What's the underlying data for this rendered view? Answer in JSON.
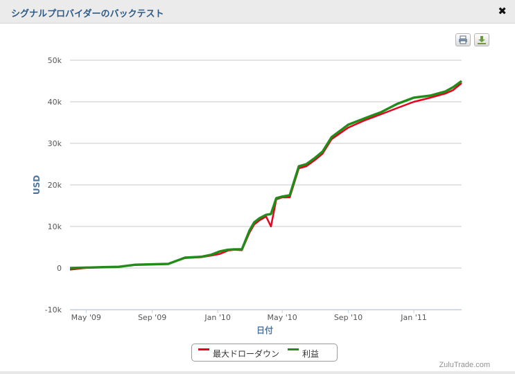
{
  "window": {
    "title": "シグナルプロバイダーのバックテスト",
    "close_symbol": "✖"
  },
  "toolbar": {
    "print_icon": "print-icon",
    "download_icon": "download-icon"
  },
  "credits": "ZuluTrade.com",
  "colors": {
    "drawdown": "#e8001c",
    "profit": "#238b1a",
    "title": "#2d5a86",
    "axis_title": "#4d759e"
  },
  "chart_data": {
    "type": "line",
    "xlabel": "日付",
    "ylabel": "USD",
    "ylim": [
      -10000,
      50000
    ],
    "yticks": [
      50000,
      40000,
      30000,
      20000,
      10000,
      0,
      -10000
    ],
    "ytick_labels": [
      "50k",
      "40k",
      "30k",
      "20k",
      "10k",
      "0",
      "-10k"
    ],
    "xlim": [
      "2009-04-01",
      "2011-03-31"
    ],
    "xticks": [
      "2009-05-01",
      "2009-09-01",
      "2010-01-01",
      "2010-05-01",
      "2010-09-01",
      "2011-01-01"
    ],
    "xtick_labels": [
      "May '09",
      "Sep '09",
      "Jan '10",
      "May '10",
      "Sep '10",
      "Jan '11"
    ],
    "legend_position": "bottom-center",
    "grid": true,
    "x": [
      "2009-04-01",
      "2009-05-01",
      "2009-06-01",
      "2009-07-01",
      "2009-08-01",
      "2009-09-01",
      "2009-10-01",
      "2009-11-01",
      "2009-12-01",
      "2009-12-20",
      "2010-01-05",
      "2010-01-20",
      "2010-02-01",
      "2010-02-15",
      "2010-03-01",
      "2010-03-10",
      "2010-03-20",
      "2010-04-01",
      "2010-04-10",
      "2010-04-20",
      "2010-05-01",
      "2010-05-15",
      "2010-06-01",
      "2010-06-15",
      "2010-07-01",
      "2010-07-15",
      "2010-08-01",
      "2010-09-01",
      "2010-10-01",
      "2010-11-01",
      "2010-12-01",
      "2011-01-01",
      "2011-02-01",
      "2011-03-01",
      "2011-03-15",
      "2011-03-31"
    ],
    "series": [
      {
        "name": "最大ドローダウン",
        "values": [
          -400,
          50,
          200,
          300,
          800,
          900,
          1000,
          2400,
          2600,
          3000,
          3400,
          4200,
          4400,
          4300,
          8500,
          10500,
          11500,
          12400,
          10000,
          16500,
          17000,
          17000,
          24000,
          24500,
          26000,
          27500,
          31000,
          33800,
          35500,
          37000,
          38500,
          40000,
          41000,
          42000,
          42800,
          44500
        ]
      },
      {
        "name": "利益",
        "values": [
          0,
          100,
          200,
          300,
          800,
          900,
          1000,
          2500,
          2700,
          3200,
          4000,
          4400,
          4500,
          4500,
          9000,
          11000,
          12000,
          12800,
          13000,
          16800,
          17200,
          17500,
          24500,
          25000,
          26500,
          28000,
          31500,
          34500,
          36000,
          37500,
          39500,
          41000,
          41500,
          42500,
          43500,
          45000
        ]
      }
    ]
  }
}
